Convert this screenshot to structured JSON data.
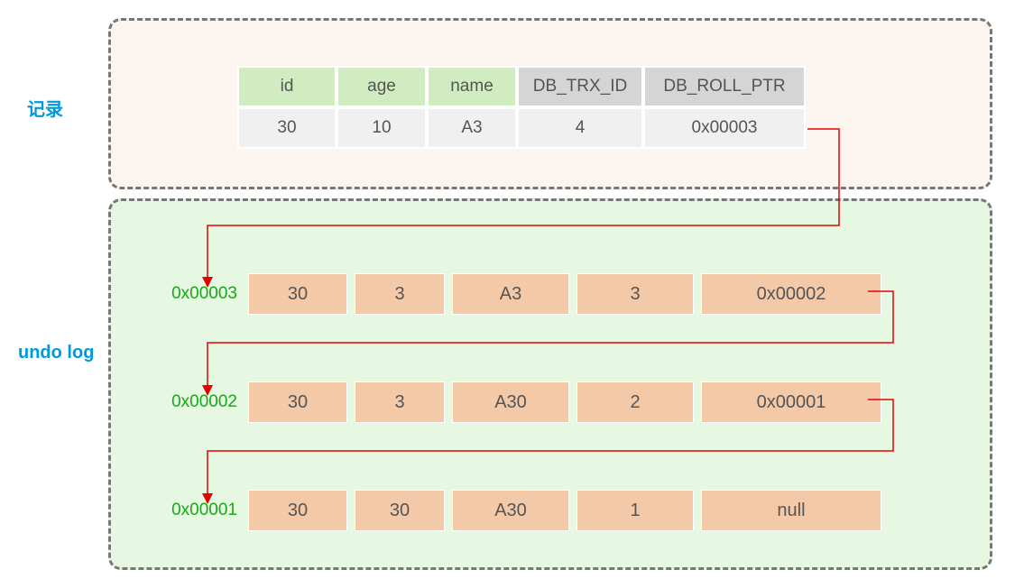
{
  "labels": {
    "record": "记录",
    "undolog": "undo log"
  },
  "record": {
    "headers": {
      "id": "id",
      "age": "age",
      "name": "name",
      "trx": "DB_TRX_ID",
      "roll": "DB_ROLL_PTR"
    },
    "row": {
      "id": "30",
      "age": "10",
      "name": "A3",
      "trx": "4",
      "roll": "0x00003"
    }
  },
  "undo": {
    "entries": [
      {
        "addr": "0x00003",
        "id": "30",
        "age": "3",
        "name": "A3",
        "trx": "3",
        "roll": "0x00002"
      },
      {
        "addr": "0x00002",
        "id": "30",
        "age": "3",
        "name": "A30",
        "trx": "2",
        "roll": "0x00001"
      },
      {
        "addr": "0x00001",
        "id": "30",
        "age": "30",
        "name": "A30",
        "trx": "1",
        "roll": "null"
      }
    ]
  }
}
